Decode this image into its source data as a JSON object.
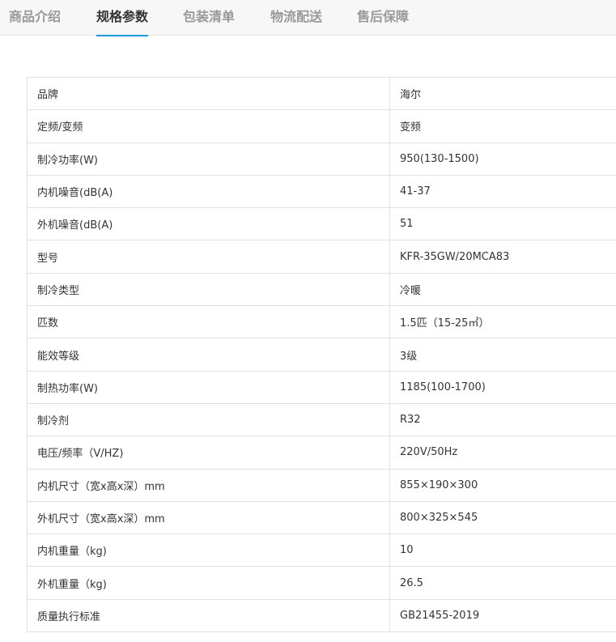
{
  "tabs": [
    {
      "label": "商品介绍",
      "active": false
    },
    {
      "label": "规格参数",
      "active": true
    },
    {
      "label": "包装清单",
      "active": false
    },
    {
      "label": "物流配送",
      "active": false
    },
    {
      "label": "售后保障",
      "active": false
    }
  ],
  "accent_color": "#1a9ad6",
  "specs": [
    {
      "key": "品牌",
      "value": "海尔"
    },
    {
      "key": "定频/变频",
      "value": "变频"
    },
    {
      "key": "制冷功率(W)",
      "value": "950(130-1500)"
    },
    {
      "key": "内机噪音(dB(A)",
      "value": "41-37"
    },
    {
      "key": "外机噪音(dB(A)",
      "value": "51"
    },
    {
      "key": "型号",
      "value": "KFR-35GW/20MCA83"
    },
    {
      "key": "制冷类型",
      "value": "冷暖"
    },
    {
      "key": "匹数",
      "value": "1.5匹（15-25㎡）"
    },
    {
      "key": "能效等级",
      "value": "3级"
    },
    {
      "key": "制热功率(W)",
      "value": "1185(100-1700)"
    },
    {
      "key": "制冷剂",
      "value": "R32"
    },
    {
      "key": "电压/频率（V/HZ)",
      "value": "220V/50Hz"
    },
    {
      "key": "内机尺寸（宽x高x深）mm",
      "value": "855×190×300"
    },
    {
      "key": "外机尺寸（宽x高x深）mm",
      "value": "800×325×545"
    },
    {
      "key": "内机重量（kg)",
      "value": "10"
    },
    {
      "key": "外机重量（kg)",
      "value": "26.5"
    },
    {
      "key": "质量执行标准",
      "value": "GB21455-2019"
    }
  ]
}
